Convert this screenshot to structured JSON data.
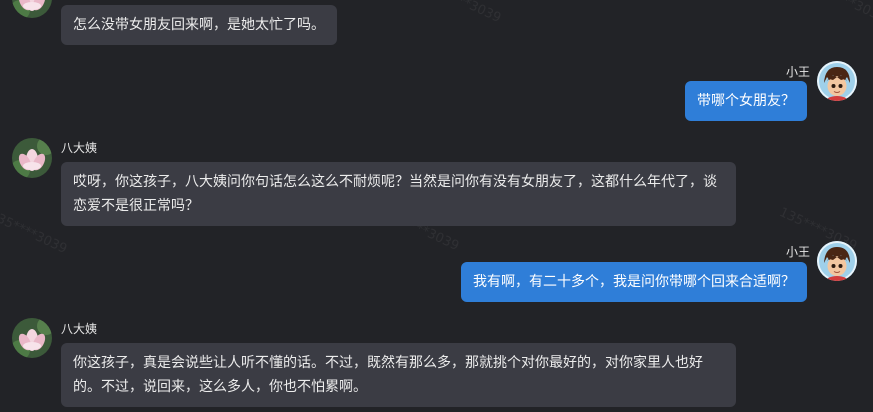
{
  "watermark_text": "135****3039",
  "messages": [
    {
      "side": "in",
      "sender": "",
      "text": "怎么没带女朋友回来啊，是她太忙了吗。"
    },
    {
      "side": "out",
      "sender": "小王",
      "text": "带哪个女朋友？"
    },
    {
      "side": "in",
      "sender": "八大姨",
      "text": "哎呀，你这孩子，八大姨问你句话怎么这么不耐烦呢？当然是问你有没有女朋友了，这都什么年代了，谈恋爱不是很正常吗？"
    },
    {
      "side": "out",
      "sender": "小王",
      "text": "我有啊，有二十多个，我是问你带哪个回来合适啊？"
    },
    {
      "side": "in",
      "sender": "八大姨",
      "text": "你这孩子，真是会说些让人听不懂的话。不过，既然有那么多，那就挑个对你最好的，对你家里人也好的。不过，说回来，这么多人，你也不怕累啊。"
    }
  ],
  "colors": {
    "background": "#222327",
    "incoming_bubble": "#3b3c44",
    "outgoing_bubble": "#2f7ed8"
  },
  "icons": {
    "aunt_avatar": "lotus-flower-avatar",
    "user_avatar": "cartoon-boy-avatar"
  }
}
